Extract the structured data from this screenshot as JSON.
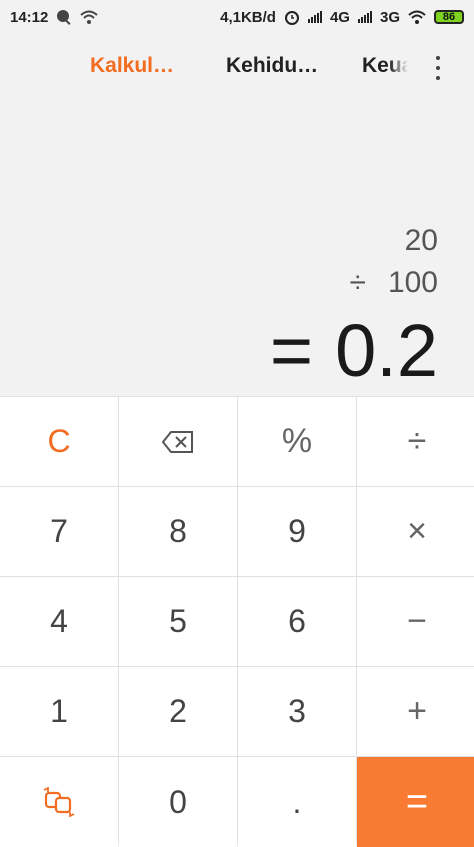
{
  "status_bar": {
    "time": "14:12",
    "network_speed": "4,1KB/d",
    "net_4g": "4G",
    "net_3g": "3G",
    "battery": "86"
  },
  "tabs": [
    {
      "label": "Kalkul…",
      "active": true
    },
    {
      "label": "Kehidu…",
      "active": false
    },
    {
      "label": "Keua",
      "active": false
    }
  ],
  "display": {
    "operand1": "20",
    "operator": "÷",
    "operand2": "100",
    "equals_sign": "=",
    "result": "0.2"
  },
  "keypad": {
    "row1": [
      "C",
      "⌫",
      "%",
      "÷"
    ],
    "row2": [
      "7",
      "8",
      "9",
      "×"
    ],
    "row3": [
      "4",
      "5",
      "6",
      "−"
    ],
    "row4": [
      "1",
      "2",
      "3",
      "+"
    ],
    "row5": [
      "swap-icon",
      "0",
      ".",
      "="
    ]
  },
  "colors": {
    "accent": "#f26d21",
    "equals_bg": "#f97a32",
    "battery": "#7ed321"
  }
}
